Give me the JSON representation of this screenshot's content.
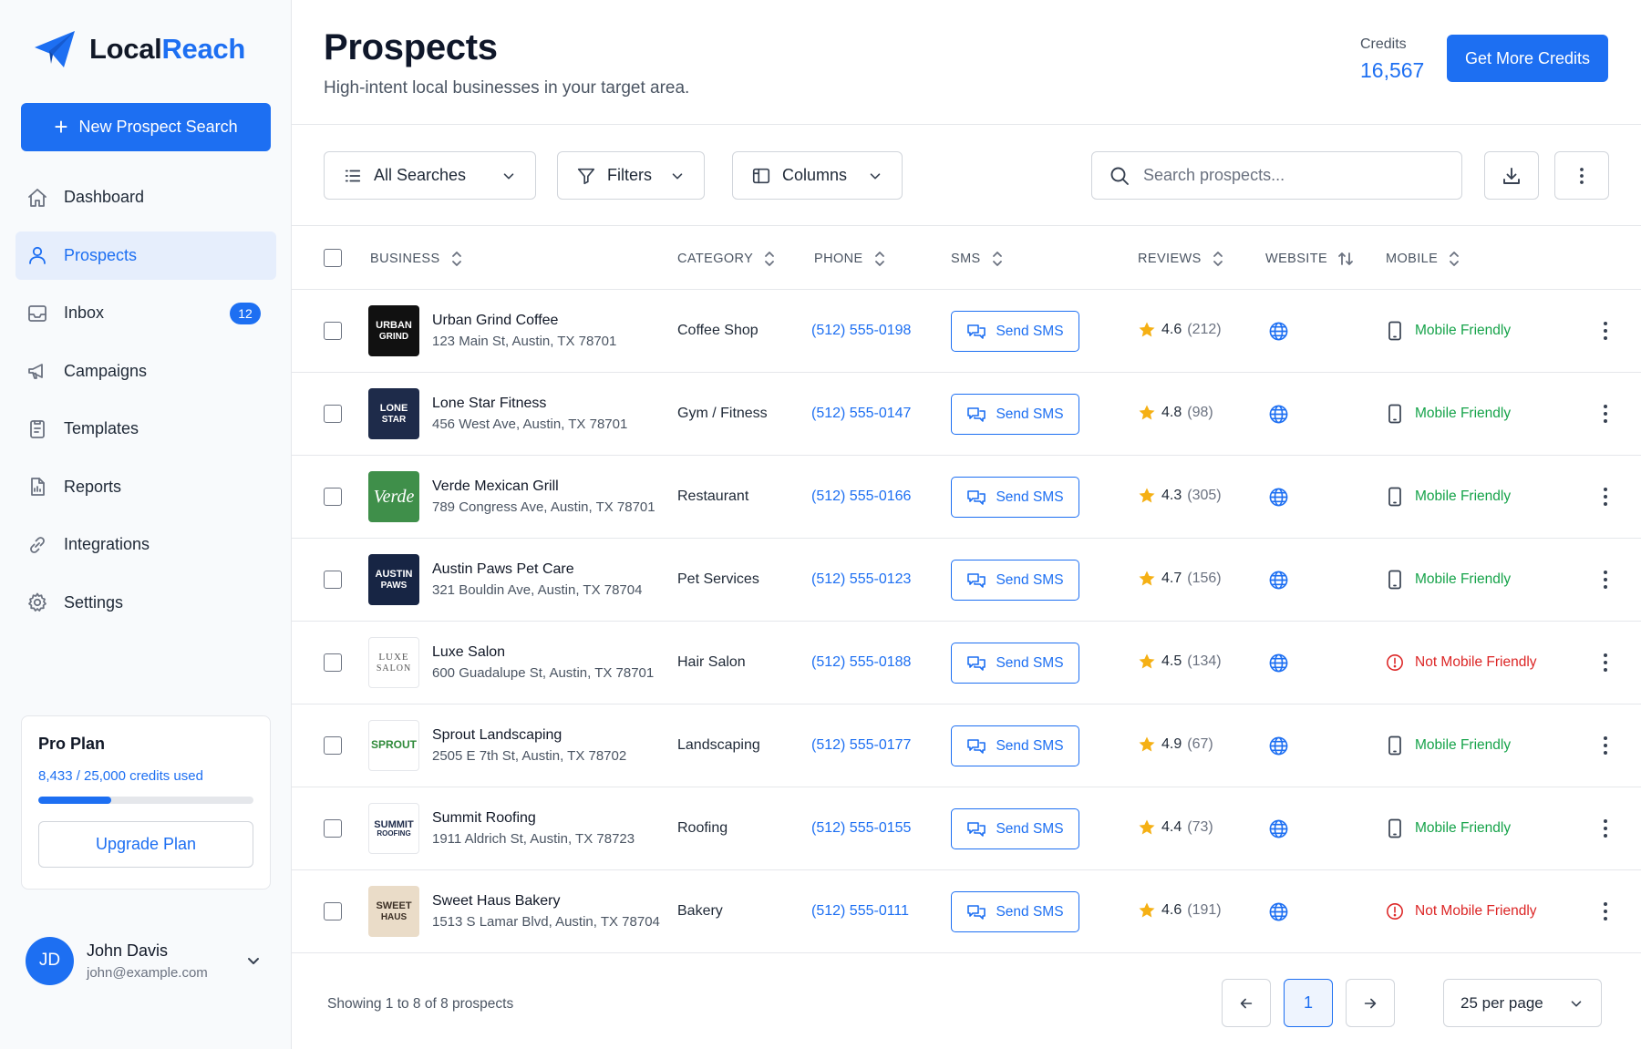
{
  "app": {
    "name_part1": "Local",
    "name_part2": "Reach",
    "brand_color": "#1d6ff2"
  },
  "sidebar": {
    "new_search_label": "New Prospect Search",
    "items": [
      {
        "label": "Dashboard",
        "icon": "home-icon",
        "active": false
      },
      {
        "label": "Prospects",
        "icon": "user-icon",
        "active": true
      },
      {
        "label": "Inbox",
        "icon": "inbox-icon",
        "active": false,
        "badge": "12"
      },
      {
        "label": "Campaigns",
        "icon": "megaphone-icon",
        "active": false
      },
      {
        "label": "Templates",
        "icon": "template-icon",
        "active": false
      },
      {
        "label": "Reports",
        "icon": "report-icon",
        "active": false
      },
      {
        "label": "Integrations",
        "icon": "link-icon",
        "active": false
      },
      {
        "label": "Settings",
        "icon": "gear-icon",
        "active": false
      }
    ],
    "plan": {
      "title": "Pro Plan",
      "usage_text": "8,433 / 25,000 credits used",
      "used_fraction": 0.337,
      "upgrade_label": "Upgrade Plan"
    },
    "user": {
      "initials": "JD",
      "name": "John Davis",
      "email": "john@example.com"
    }
  },
  "header": {
    "title": "Prospects",
    "subtitle": "High-intent local businesses in your target area.",
    "credits_label": "Credits",
    "credits_value": "16,567",
    "get_credits_label": "Get More Credits"
  },
  "toolbar": {
    "searches_label": "All Searches",
    "filters_label": "Filters",
    "columns_label": "Columns",
    "search_placeholder": "Search prospects..."
  },
  "table": {
    "columns": [
      "BUSINESS",
      "CATEGORY",
      "PHONE",
      "SMS",
      "REVIEWS",
      "WEBSITE",
      "MOBILE"
    ],
    "rows": [
      {
        "name": "Urban Grind Coffee",
        "address": "123 Main St, Austin, TX 78701",
        "category": "Coffee Shop",
        "phone": "(512) 555-0198",
        "sms": "Send SMS",
        "rating": "4.6",
        "reviews": "(212)",
        "mobile": "Mobile Friendly",
        "mobile_ok": true,
        "logo_lines": [
          "URBAN",
          "GRIND"
        ],
        "logo_bg": "#111111",
        "logo_fg": "#ffffff"
      },
      {
        "name": "Lone Star Fitness",
        "address": "456 West Ave, Austin, TX 78701",
        "category": "Gym / Fitness",
        "phone": "(512) 555-0147",
        "sms": "Send SMS",
        "rating": "4.8",
        "reviews": "(98)",
        "mobile": "Mobile Friendly",
        "mobile_ok": true,
        "logo_lines": [
          "LONE",
          "STAR"
        ],
        "logo_bg": "#1e2b4a",
        "logo_fg": "#ffffff"
      },
      {
        "name": "Verde Mexican Grill",
        "address": "789 Congress Ave, Austin, TX 78701",
        "category": "Restaurant",
        "phone": "(512) 555-0166",
        "sms": "Send SMS",
        "rating": "4.3",
        "reviews": "(305)",
        "mobile": "Mobile Friendly",
        "mobile_ok": true,
        "logo_lines": [
          "Verde"
        ],
        "logo_bg": "#3f8f4a",
        "logo_fg": "#ffffff"
      },
      {
        "name": "Austin Paws Pet Care",
        "address": "321 Bouldin Ave, Austin, TX 78704",
        "category": "Pet Services",
        "phone": "(512) 555-0123",
        "sms": "Send SMS",
        "rating": "4.7",
        "reviews": "(156)",
        "mobile": "Mobile Friendly",
        "mobile_ok": true,
        "logo_lines": [
          "AUSTIN",
          "PAWS"
        ],
        "logo_bg": "#172544",
        "logo_fg": "#ffffff"
      },
      {
        "name": "Luxe Salon",
        "address": "600 Guadalupe St, Austin, TX 78701",
        "category": "Hair Salon",
        "phone": "(512) 555-0188",
        "sms": "Send SMS",
        "rating": "4.5",
        "reviews": "(134)",
        "mobile": "Not Mobile Friendly",
        "mobile_ok": false,
        "logo_lines": [
          "LUXE",
          "SALON"
        ],
        "logo_bg": "#ffffff",
        "logo_fg": "#555555"
      },
      {
        "name": "Sprout Landscaping",
        "address": "2505 E 7th St, Austin, TX 78702",
        "category": "Landscaping",
        "phone": "(512) 555-0177",
        "sms": "Send SMS",
        "rating": "4.9",
        "reviews": "(67)",
        "mobile": "Mobile Friendly",
        "mobile_ok": true,
        "logo_lines": [
          "SPROUT"
        ],
        "logo_bg": "#ffffff",
        "logo_fg": "#2f8a3a"
      },
      {
        "name": "Summit Roofing",
        "address": "1911 Aldrich St, Austin, TX 78723",
        "category": "Roofing",
        "phone": "(512) 555-0155",
        "sms": "Send SMS",
        "rating": "4.4",
        "reviews": "(73)",
        "mobile": "Mobile Friendly",
        "mobile_ok": true,
        "logo_lines": [
          "SUMMIT",
          "ROOFING"
        ],
        "logo_bg": "#ffffff",
        "logo_fg": "#1e2b4a"
      },
      {
        "name": "Sweet Haus Bakery",
        "address": "1513 S Lamar Blvd, Austin, TX 78704",
        "category": "Bakery",
        "phone": "(512) 555-0111",
        "sms": "Send SMS",
        "rating": "4.6",
        "reviews": "(191)",
        "mobile": "Not Mobile Friendly",
        "mobile_ok": false,
        "logo_lines": [
          "SWEET",
          "HAUS"
        ],
        "logo_bg": "#eadcc8",
        "logo_fg": "#3b2f25"
      }
    ]
  },
  "footer": {
    "showing_text": "Showing 1 to 8 of 8 prospects",
    "current_page": "1",
    "per_page_label": "25 per page"
  },
  "colors": {
    "accent": "#1d6ff2",
    "success": "#16a34a",
    "danger": "#dc2626",
    "star": "#f5b014"
  }
}
